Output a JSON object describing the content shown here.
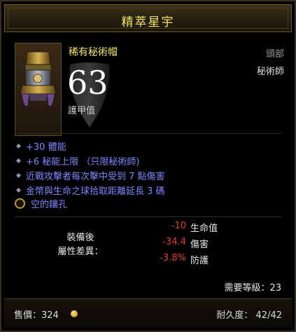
{
  "header": {
    "title": "精萃星宇"
  },
  "item": {
    "name": "稀有秘術帽",
    "slot": "頭部",
    "class": "秘術師",
    "icon": "wizard-hat-icon",
    "armor_value": "63",
    "armor_label": "護甲值"
  },
  "affixes": [
    {
      "text": "+30 體能"
    },
    {
      "text": "+6 秘能上限 （只限秘術師)"
    },
    {
      "text": "近戰攻擊者每次擊中受到 7 點傷害"
    },
    {
      "text": "金幣與生命之球拾取距離延長 3 碼"
    }
  ],
  "socket": {
    "label": "空的鑲孔"
  },
  "comparison": {
    "title_line1": "裝備後",
    "title_line2": "屬性差異：",
    "rows": [
      {
        "value": "-10",
        "name": "生命值"
      },
      {
        "value": "-34.4",
        "name": "傷害"
      },
      {
        "value": "-3.8%",
        "name": "防護"
      }
    ]
  },
  "requirement": "需要等級：23",
  "footer": {
    "sell": "售價：324",
    "durability": "耐久度： 42/42"
  },
  "colors": {
    "title": "#f6e36a",
    "item_name": "#f3e66a",
    "affix": "#7d86ff",
    "negative": "#e83a3a"
  }
}
